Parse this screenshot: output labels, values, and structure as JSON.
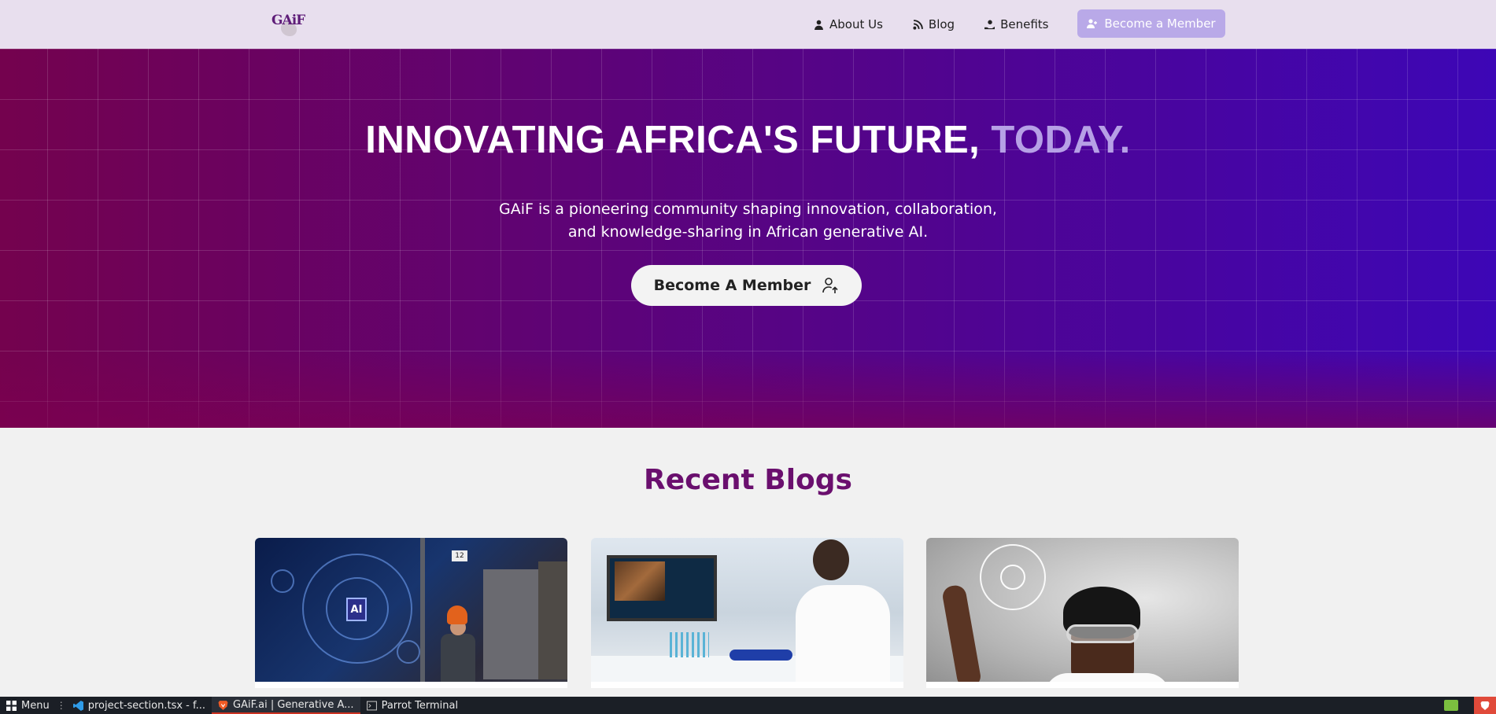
{
  "nav": {
    "logo": "GAiF",
    "links": [
      {
        "label": "About Us",
        "icon": "person-icon"
      },
      {
        "label": "Blog",
        "icon": "rss-icon"
      },
      {
        "label": "Benefits",
        "icon": "hand-user-icon"
      }
    ],
    "cta_label": "Become a Member"
  },
  "hero": {
    "title_main": "INNOVATING AFRICA'S FUTURE, ",
    "title_accent": "TODAY.",
    "subtitle_line1": "GAiF is a pioneering community shaping innovation, collaboration,",
    "subtitle_line2": "and knowledge-sharing in African generative AI.",
    "button_label": "Become A Member"
  },
  "blogs": {
    "heading": "Recent Blogs",
    "cards": [
      {
        "image": "ai-warehouse-worker",
        "image_text": "AI",
        "sign": "12"
      },
      {
        "image": "lab-scientist-microscope"
      },
      {
        "image": "man-goggles-touch-screen"
      }
    ]
  },
  "taskbar": {
    "menu_label": "Menu",
    "items": [
      {
        "label": "project-section.tsx - f...",
        "icon": "vscode-icon"
      },
      {
        "label": "GAiF.ai | Generative A...",
        "icon": "brave-icon"
      },
      {
        "label": "Parrot Terminal",
        "icon": "terminal-icon"
      }
    ]
  },
  "colors": {
    "brand": "#6a0f6e",
    "accent": "#b6a0e6",
    "hero_start": "#74024e",
    "hero_end": "#3d06b6",
    "nav_bg": "#e8dfee",
    "cta_bg": "#b9a9e8"
  }
}
